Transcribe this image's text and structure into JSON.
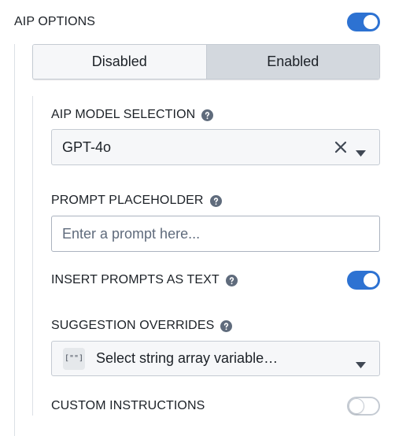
{
  "aip_options": {
    "label": "AIP OPTIONS",
    "toggle_on": true
  },
  "mode_switch": {
    "options": [
      "Disabled",
      "Enabled"
    ],
    "selected": "Enabled"
  },
  "model_selection": {
    "label": "AIP MODEL SELECTION",
    "value": "GPT-4o"
  },
  "prompt_placeholder": {
    "label": "PROMPT PLACEHOLDER",
    "placeholder": "Enter a prompt here..."
  },
  "insert_prompts": {
    "label": "INSERT PROMPTS AS TEXT",
    "toggle_on": true
  },
  "suggestion_overrides": {
    "label": "SUGGESTION OVERRIDES",
    "icon_text": "[\"\"]",
    "placeholder": "Select string array variable…"
  },
  "custom_instructions": {
    "label": "CUSTOM INSTRUCTIONS",
    "toggle_on": false
  },
  "colors": {
    "accent": "#2d72d2",
    "border": "#c5cbd3",
    "selected_segment": "#d3d8de"
  },
  "icons": {
    "help": "help-icon",
    "clear": "close-icon",
    "caret": "caret-down-icon",
    "variable": "array-variable-icon"
  }
}
